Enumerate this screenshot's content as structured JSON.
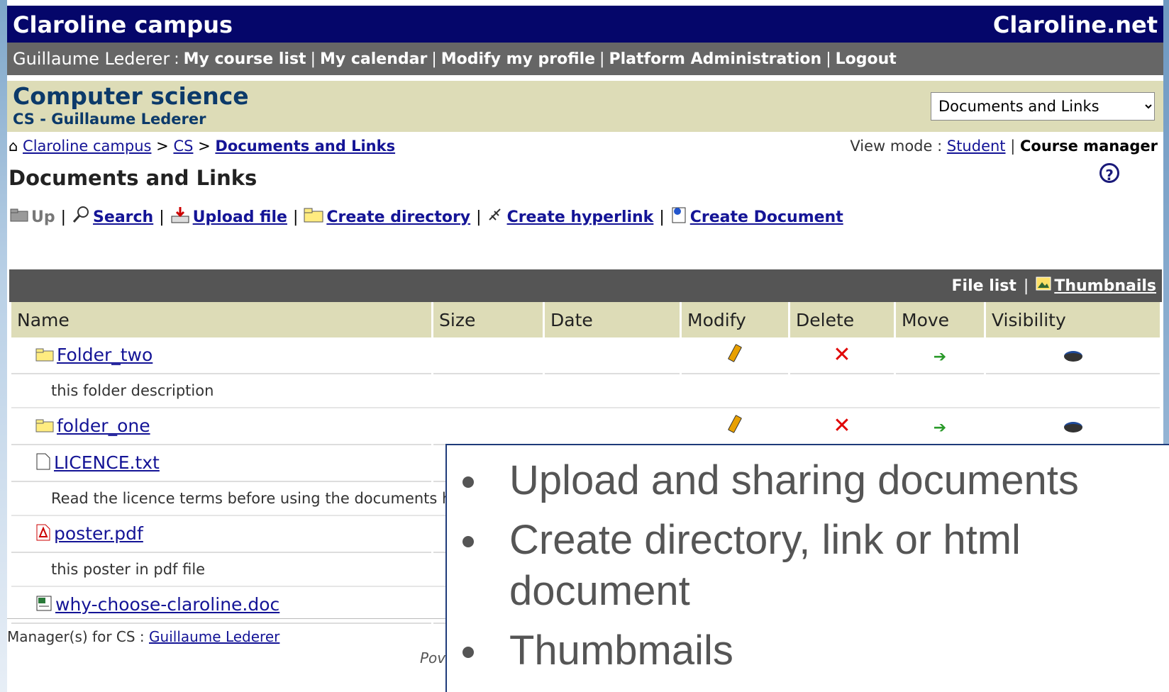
{
  "header": {
    "campus": "Claroline campus",
    "site": "Claroline.net"
  },
  "userbar": {
    "username": "Guillaume Lederer",
    "colon": " : ",
    "links": [
      "My course list",
      "My calendar",
      "Modify my profile",
      "Platform Administration",
      "Logout"
    ]
  },
  "course": {
    "title": "Computer science",
    "subtitle": "CS - Guillaume Lederer",
    "tool_select": "Documents and Links"
  },
  "breadcrumb": {
    "items": [
      "Claroline campus",
      "CS",
      "Documents and Links"
    ]
  },
  "viewmode": {
    "label": "View mode : ",
    "student": "Student",
    "manager": "Course manager"
  },
  "page_title": "Documents and Links",
  "toolbar": {
    "up": "Up",
    "search": "Search",
    "upload": "Upload file",
    "create_dir": "Create directory",
    "create_link": "Create hyperlink",
    "create_doc": "Create Document"
  },
  "filehead": {
    "file_list": "File list",
    "thumbnails": "Thumbnails"
  },
  "columns": [
    "Name",
    "Size",
    "Date",
    "Modify",
    "Delete",
    "Move",
    "Visibility"
  ],
  "files": [
    {
      "name": "Folder_two",
      "type": "folder-icon",
      "description": "this folder description"
    },
    {
      "name": "folder_one",
      "type": "folder-icon",
      "description": ""
    },
    {
      "name": "LICENCE.txt",
      "type": "file-icon",
      "description": "Read the licence terms before using the documents h"
    },
    {
      "name": "poster.pdf",
      "type": "pdf-icon",
      "description": "this poster in pdf file"
    },
    {
      "name": "why-choose-claroline.doc",
      "type": "doc-icon",
      "description": ""
    }
  ],
  "footer": {
    "managers_label": "Manager(s) for CS : ",
    "manager": "Guillaume Lederer",
    "powered": "Pov"
  },
  "overlay": {
    "bullets": [
      "Upload and sharing documents",
      "Create directory, link or html document",
      "Thumbmails"
    ]
  }
}
